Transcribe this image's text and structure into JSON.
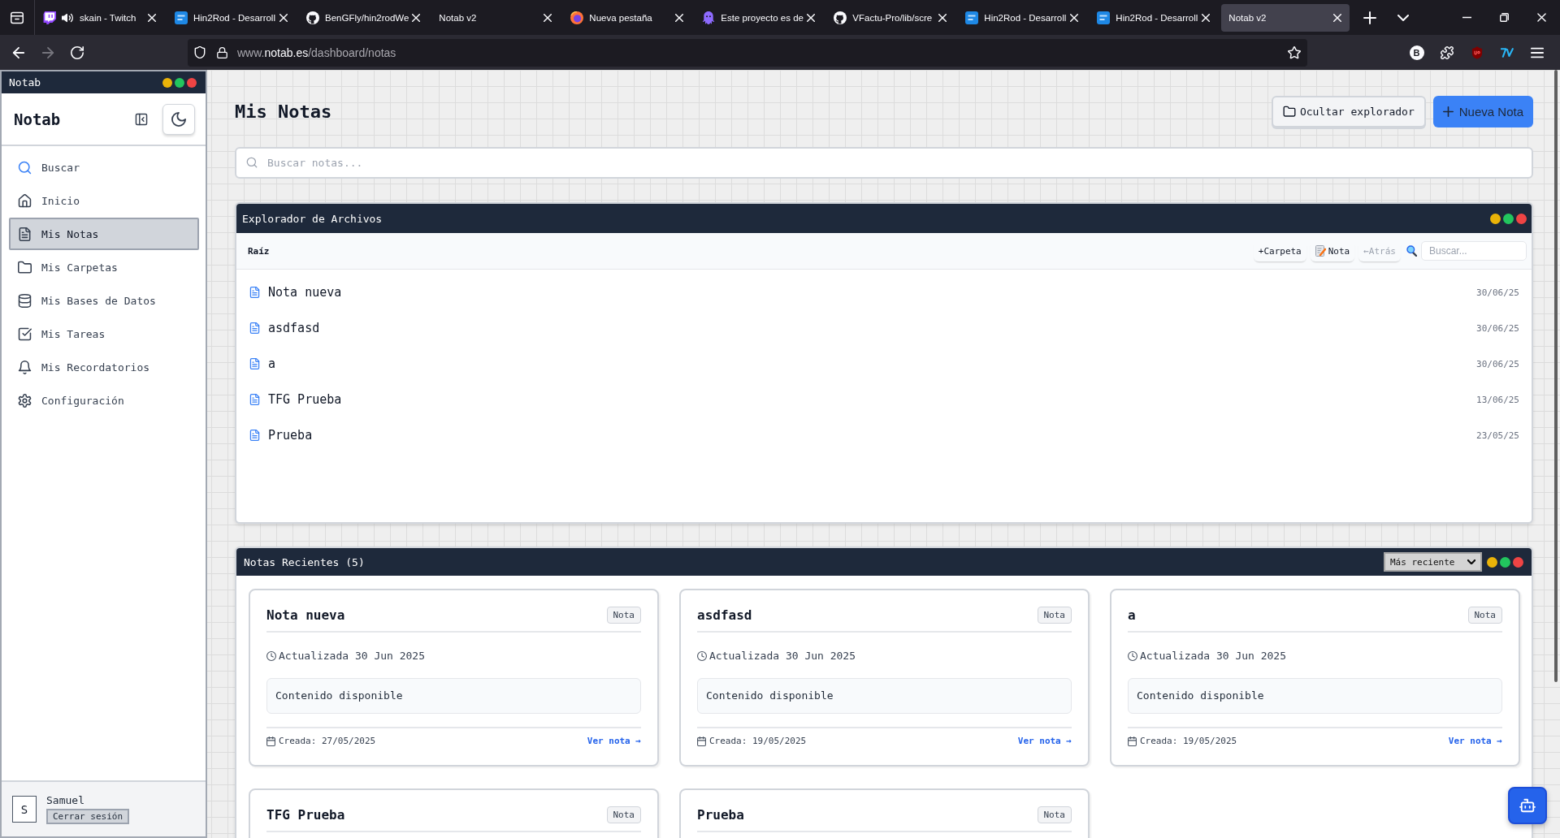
{
  "browser": {
    "tabs": [
      {
        "kind": "stream",
        "title": "skain - Twitch",
        "audio": true,
        "selected": false
      },
      {
        "kind": "app",
        "title": "Hin2Rod - Desarroll",
        "audio": false,
        "selected": false
      },
      {
        "kind": "repo",
        "title": "BenGFly/hin2rodWe",
        "audio": false,
        "selected": false
      },
      {
        "kind": "plain",
        "title": "Notab v2",
        "audio": false,
        "selected": false
      },
      {
        "kind": "browser",
        "title": "Nueva pestaña",
        "audio": false,
        "selected": false
      },
      {
        "kind": "chat",
        "title": "Este proyecto es de",
        "audio": false,
        "selected": false
      },
      {
        "kind": "repo",
        "title": "VFactu-Pro/lib/scre",
        "audio": false,
        "selected": false
      },
      {
        "kind": "app",
        "title": "Hin2Rod - Desarroll",
        "audio": false,
        "selected": false
      },
      {
        "kind": "app",
        "title": "Hin2Rod - Desarroll",
        "audio": false,
        "selected": false
      },
      {
        "kind": "plain",
        "title": "Notab v2",
        "audio": false,
        "selected": true
      }
    ],
    "nav": [
      {
        "kind": "back",
        "disabled": false
      },
      {
        "kind": "forward",
        "disabled": true
      },
      {
        "kind": "reload",
        "disabled": false
      }
    ],
    "url": {
      "host_prefix": "www.",
      "domain": "notab.es",
      "path": "/dashboard/notas"
    },
    "extensions": [
      {
        "kind": "letter",
        "label": "B"
      },
      {
        "kind": "puzzle"
      },
      {
        "kind": "shield"
      },
      {
        "kind": "logo"
      }
    ]
  },
  "sidebar": {
    "window_title": "Notab",
    "brand": "Notab",
    "items": [
      {
        "label": "Buscar",
        "selected": false
      },
      {
        "label": "Inicio",
        "selected": false
      },
      {
        "label": "Mis Notas",
        "selected": true
      },
      {
        "label": "Mis Carpetas",
        "selected": false
      },
      {
        "label": "Mis Bases de Datos",
        "selected": false
      },
      {
        "label": "Mis Tareas",
        "selected": false
      },
      {
        "label": "Mis Recordatorios",
        "selected": false
      },
      {
        "label": "Configuración",
        "selected": false
      }
    ],
    "user": {
      "initial": "S",
      "name": "Samuel",
      "logout": "Cerrar sesión"
    }
  },
  "header": {
    "title": "Mis Notas",
    "buttons": [
      {
        "kind": "toggle",
        "label": "Ocultar explorador"
      },
      {
        "kind": "primary",
        "label": "Nueva Nota"
      }
    ]
  },
  "search": {
    "placeholder": "Buscar notas..."
  },
  "explorer": {
    "title": "Explorador de Archivos",
    "path": "Raíz",
    "actions": [
      {
        "kind": "add",
        "label": "+Carpeta",
        "disabled": false
      },
      {
        "kind": "note",
        "label": "Nota",
        "disabled": false
      },
      {
        "kind": "back",
        "label": "←Atrás",
        "disabled": true
      }
    ],
    "search": {
      "placeholder": "Buscar..."
    },
    "files": [
      {
        "name": "Nota nueva",
        "date": "30/06/25"
      },
      {
        "name": "asdfasd",
        "date": "30/06/25"
      },
      {
        "name": "a",
        "date": "30/06/25"
      },
      {
        "name": "TFG Prueba",
        "date": "13/06/25"
      },
      {
        "name": "Prueba",
        "date": "23/05/25"
      }
    ]
  },
  "recent": {
    "title": "Notas Recientes (5)",
    "sort": "Más reciente",
    "cards": [
      {
        "title": "Nota nueva",
        "badge": "Nota",
        "updated": "Actualizada 30 Jun 2025",
        "content": "Contenido disponible",
        "created": "Creada: 27/05/2025",
        "link": "Ver nota →"
      },
      {
        "title": "asdfasd",
        "badge": "Nota",
        "updated": "Actualizada 30 Jun 2025",
        "content": "Contenido disponible",
        "created": "Creada: 19/05/2025",
        "link": "Ver nota →"
      },
      {
        "title": "a",
        "badge": "Nota",
        "updated": "Actualizada 30 Jun 2025",
        "content": "Contenido disponible",
        "created": "Creada: 19/05/2025",
        "link": "Ver nota →"
      },
      {
        "title": "TFG Prueba",
        "badge": "Nota"
      },
      {
        "title": "Prueba",
        "badge": "Nota"
      }
    ]
  }
}
